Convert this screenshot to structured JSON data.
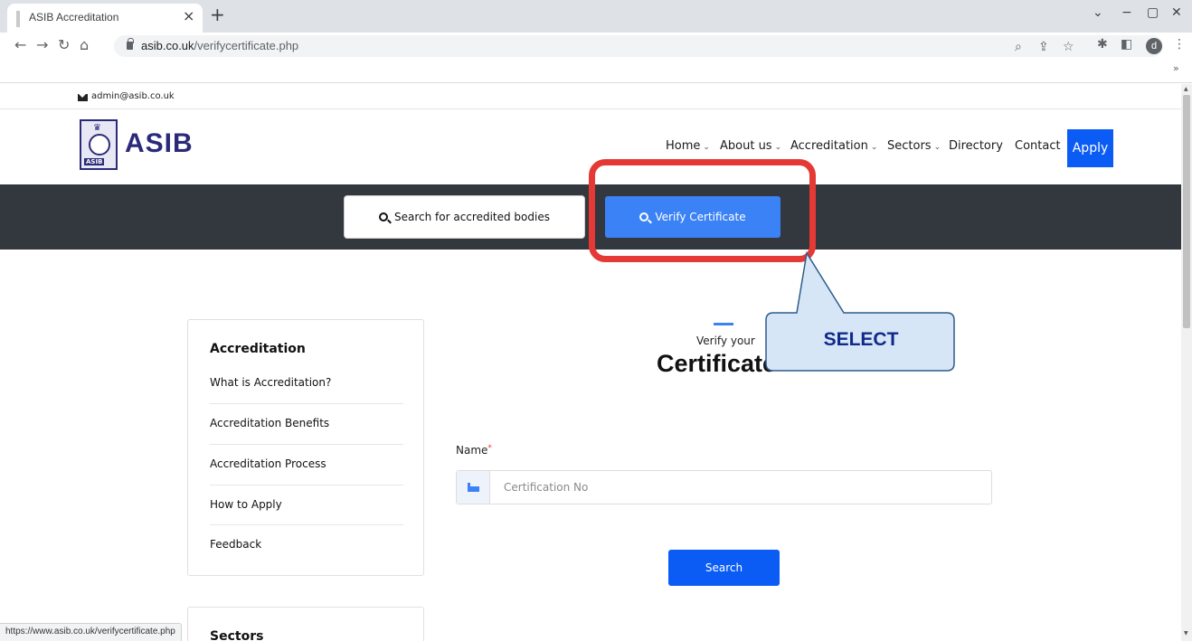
{
  "browser": {
    "tab_title": "ASIB Accreditation",
    "tab_close": "×",
    "new_tab": "+",
    "url_domain": "asib.co.uk",
    "url_path": "/verifycertificate.php",
    "profile_initial": "d",
    "bookmarks_more": "»",
    "status_url": "https://www.asib.co.uk/verifycertificate.php"
  },
  "topbar": {
    "email": "admin@asib.co.uk"
  },
  "header": {
    "logo_text": "ASIB",
    "logo_mini": "ASIB",
    "nav": [
      {
        "label": "Home",
        "dropdown": true
      },
      {
        "label": "About us",
        "dropdown": true
      },
      {
        "label": "Accreditation",
        "dropdown": true
      },
      {
        "label": "Sectors",
        "dropdown": true
      },
      {
        "label": "Directory",
        "dropdown": false
      },
      {
        "label": "Contact",
        "dropdown": false
      }
    ],
    "apply_label": "Apply",
    "chevron": "⌄"
  },
  "search_band": {
    "search_bodies_label": "Search for accredited bodies",
    "verify_label": "Verify Certificate"
  },
  "sidebar": {
    "heading": "Accreditation",
    "items": [
      "What is Accreditation?",
      "Accreditation Benefits",
      "Accreditation Process",
      "How to Apply",
      "Feedback"
    ],
    "sectors_heading": "Sectors"
  },
  "main": {
    "subtitle": "Verify your",
    "title": "Certificate",
    "name_label": "Name",
    "required_mark": "*",
    "cert_placeholder": "Certification No",
    "search_button": "Search"
  },
  "annotation": {
    "callout_text": "SELECT",
    "highlight_color": "#e53935",
    "callout_fill": "#d7e6f7"
  },
  "colors": {
    "accent": "#3b82f6",
    "brand": "#2b2a7a",
    "primary_button": "#0b5cf5",
    "band": "#33373e"
  }
}
